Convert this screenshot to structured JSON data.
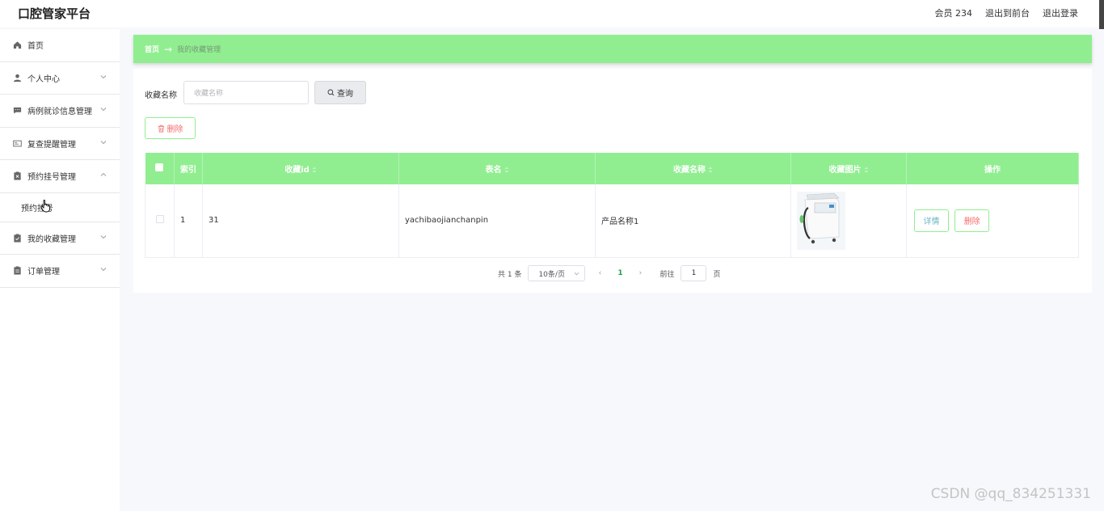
{
  "header": {
    "brand": "口腔管家平台",
    "user": "会员 234",
    "to_front": "退出到前台",
    "logout": "退出登录"
  },
  "sidebar": {
    "items": [
      {
        "label": "首页",
        "icon": "home-icon"
      },
      {
        "label": "个人中心",
        "icon": "user-icon"
      },
      {
        "label": "病例就诊信息管理",
        "icon": "message-icon"
      },
      {
        "label": "复查提醒管理",
        "icon": "card-icon"
      },
      {
        "label": "预约挂号管理",
        "icon": "clipboard-x-icon"
      },
      {
        "label": "我的收藏管理",
        "icon": "clipboard-check-icon"
      },
      {
        "label": "订单管理",
        "icon": "document-icon"
      }
    ],
    "submenu_label": "预约挂号"
  },
  "breadcrumb": {
    "home": "首页",
    "arrow": "→",
    "current": "我的收藏管理"
  },
  "search": {
    "label": "收藏名称",
    "placeholder": "收藏名称",
    "query_label": "查询"
  },
  "toolbar": {
    "delete_label": "删除"
  },
  "table": {
    "headers": {
      "index": "索引",
      "fav_id": "收藏id",
      "table_name": "表名",
      "fav_name": "收藏名称",
      "fav_image": "收藏图片",
      "action": "操作"
    },
    "rows": [
      {
        "index": "1",
        "fav_id": "31",
        "table_name": "yachibaojianchanpin",
        "fav_name": "产品名称1",
        "detail_label": "详情",
        "delete_label": "删除"
      }
    ]
  },
  "pagination": {
    "total": "共 1 条",
    "page_size": "10条/页",
    "prev": "‹",
    "current_page": "1",
    "next": "›",
    "goto_label": "前往",
    "goto_value": "1",
    "page_suffix": "页"
  },
  "watermark": "CSDN @qq_834251331",
  "colors": {
    "accent_green": "#90ee90",
    "danger": "#f56c6c",
    "detail": "#67b7c1"
  }
}
